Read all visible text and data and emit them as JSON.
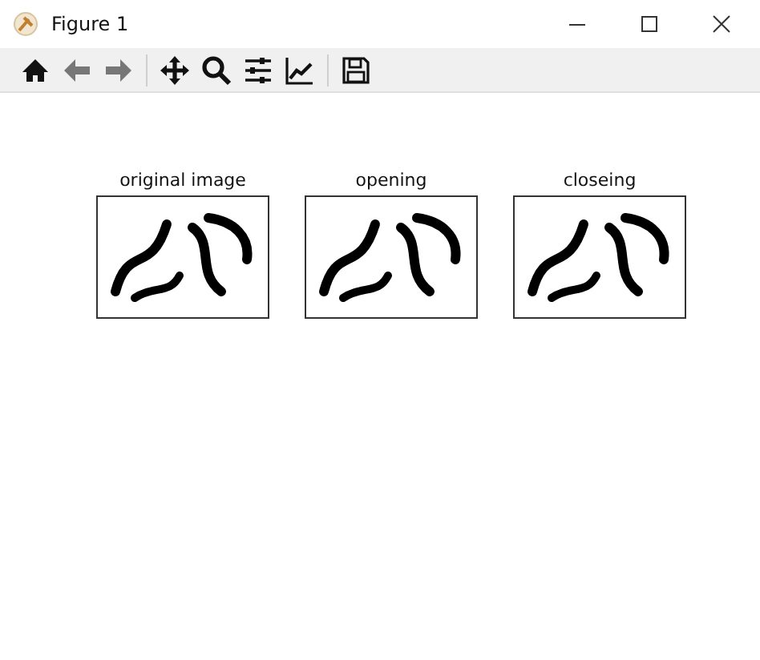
{
  "window": {
    "title": "Figure 1"
  },
  "panels": [
    {
      "title": "original image",
      "kind": "picture"
    },
    {
      "title": "opening",
      "kind": "picture"
    },
    {
      "title": "closeing",
      "kind": "picture"
    }
  ]
}
